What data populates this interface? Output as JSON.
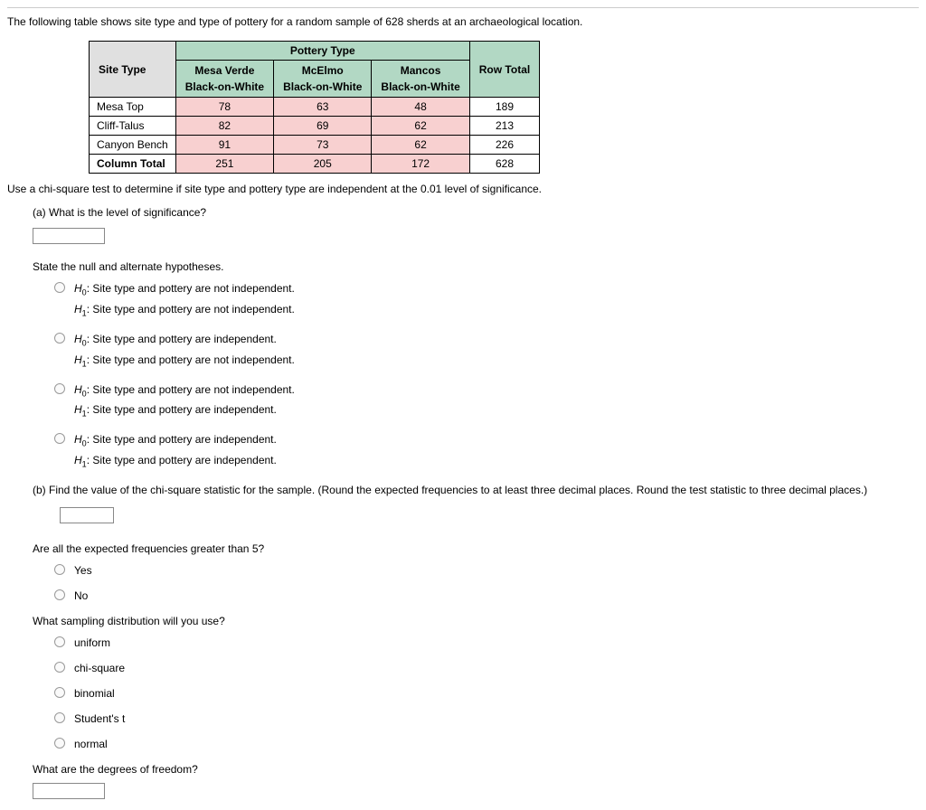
{
  "intro": "The following table shows site type and type of pottery for a random sample of 628 sherds at an archaeological location.",
  "table": {
    "pottery_type_header": "Pottery Type",
    "site_type_header": "Site Type",
    "col_headers": [
      "Mesa Verde",
      "McElmo",
      "Mancos"
    ],
    "sub_header": "Black-on-White",
    "row_total_header": "Row Total",
    "rows": [
      {
        "label": "Mesa Top",
        "cells": [
          "78",
          "63",
          "48"
        ],
        "total": "189"
      },
      {
        "label": "Cliff-Talus",
        "cells": [
          "82",
          "69",
          "62"
        ],
        "total": "213"
      },
      {
        "label": "Canyon Bench",
        "cells": [
          "91",
          "73",
          "62"
        ],
        "total": "226"
      }
    ],
    "column_total_label": "Column Total",
    "column_totals": [
      "251",
      "205",
      "172"
    ],
    "grand_total": "628"
  },
  "instruction": "Use a chi-square test to determine if site type and pottery type are independent at the 0.01 level of significance.",
  "part_a": {
    "question": "(a) What is the level of significance?",
    "hypotheses_prompt": "State the null and alternate hypotheses.",
    "options": [
      {
        "h0": "Site type and pottery are not independent.",
        "h1": "Site type and pottery are not independent."
      },
      {
        "h0": "Site type and pottery are independent.",
        "h1": "Site type and pottery are not independent."
      },
      {
        "h0": "Site type and pottery are not independent.",
        "h1": "Site type and pottery are independent."
      },
      {
        "h0": "Site type and pottery are independent.",
        "h1": "Site type and pottery are independent."
      }
    ]
  },
  "part_b": {
    "question": "(b) Find the value of the chi-square statistic for the sample. (Round the expected frequencies to at least three decimal places. Round the test statistic to three decimal places.)",
    "expected_prompt": "Are all the expected frequencies greater than 5?",
    "expected_options": [
      "Yes",
      "No"
    ],
    "dist_prompt": "What sampling distribution will you use?",
    "dist_options": [
      "uniform",
      "chi-square",
      "binomial",
      "Student's t",
      "normal"
    ],
    "df_prompt": "What are the degrees of freedom?"
  },
  "labels": {
    "h0_prefix": "H",
    "h0_sub": "0",
    "h1_prefix": "H",
    "h1_sub": "1",
    "colon": ": "
  }
}
